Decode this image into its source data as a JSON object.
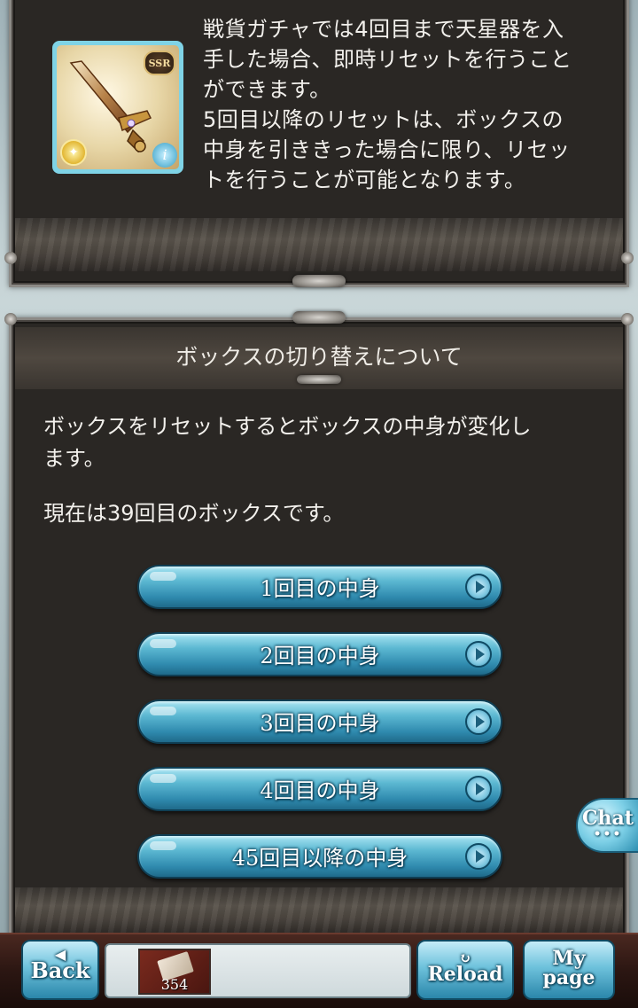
{
  "reward_panel": {
    "item_rarity": "SSR",
    "description_lines": [
      "戦貨ガチャでは4回目まで天星器を入",
      "手した場合、即時リセットを行うこと",
      "ができます。",
      "5回目以降のリセットは、ボックスの",
      "中身を引ききった場合に限り、リセッ",
      "トを行うことが可能となります。"
    ]
  },
  "box_switch": {
    "title": "ボックスの切り替えについて",
    "paragraph1_line1": "ボックスをリセットするとボックスの中身が変化し",
    "paragraph1_line2": "ます。",
    "paragraph2": "現在は39回目のボックスです。",
    "buttons": [
      {
        "label": "1回目の中身"
      },
      {
        "label": "2回目の中身"
      },
      {
        "label": "3回目の中身"
      },
      {
        "label": "4回目の中身"
      },
      {
        "label": "45回目以降の中身"
      }
    ]
  },
  "chat": {
    "label": "Chat",
    "dots": "•••"
  },
  "footer": {
    "back_label": "Back",
    "item_count": "354",
    "reload_label": "Reload",
    "mypage_line1": "My",
    "mypage_line2": "page",
    "icons": {
      "back": "left-arrow-icon",
      "reload": "reload-icon"
    }
  }
}
